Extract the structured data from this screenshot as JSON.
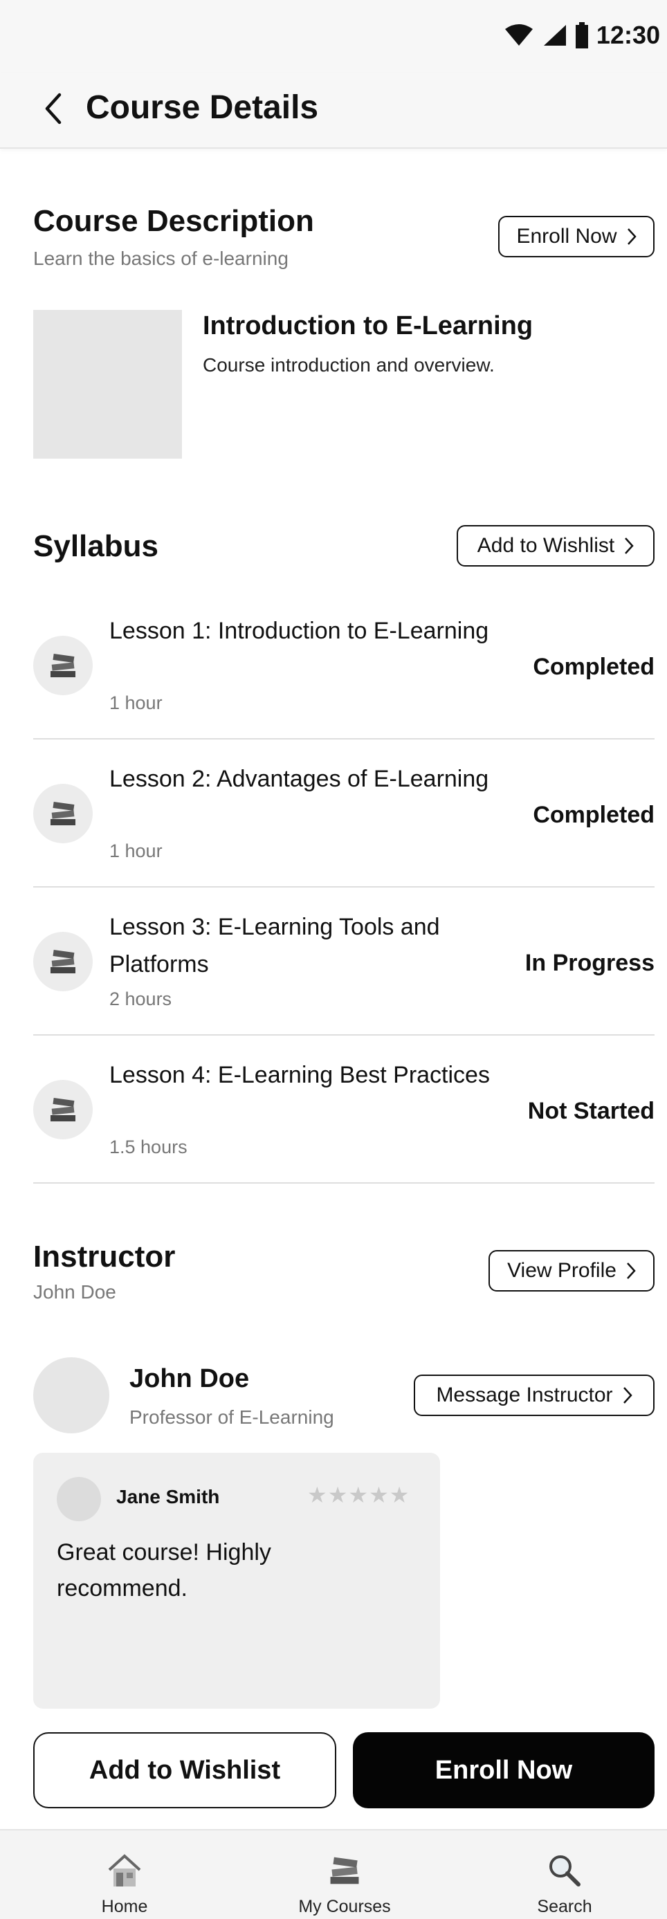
{
  "status_bar": {
    "time": "12:30"
  },
  "app_bar": {
    "title": "Course Details"
  },
  "course_description": {
    "heading": "Course Description",
    "subtitle": "Learn the basics of e-learning",
    "enroll_button": "Enroll Now",
    "course_title": "Introduction to E-Learning",
    "course_summary": "Course introduction and overview."
  },
  "syllabus": {
    "heading": "Syllabus",
    "wishlist_button": "Add to Wishlist",
    "lessons": [
      {
        "title": "Lesson 1: Introduction to E-Learning",
        "duration": "1 hour",
        "status": "Completed",
        "icon": "books-icon"
      },
      {
        "title": "Lesson 2: Advantages of E-Learning",
        "duration": "1 hour",
        "status": "Completed",
        "icon": "books-icon"
      },
      {
        "title": "Lesson 3: E-Learning Tools and Platforms",
        "duration": "2 hours",
        "status": "In Progress",
        "icon": "books-icon"
      },
      {
        "title": "Lesson 4: E-Learning Best Practices",
        "duration": "1.5 hours",
        "status": "Not Started",
        "icon": "books-icon"
      }
    ]
  },
  "instructor": {
    "heading": "Instructor",
    "subtitle": "John Doe",
    "view_profile_button": "View Profile",
    "name": "John Doe",
    "role": "Professor of E-Learning",
    "message_button": "Message Instructor"
  },
  "review": {
    "reviewer": "Jane Smith",
    "stars": "★★★★★",
    "text": "Great course! Highly recommend."
  },
  "cta": {
    "wishlist": "Add to Wishlist",
    "enroll": "Enroll Now"
  },
  "bottom_nav": {
    "items": [
      {
        "label": "Home",
        "icon": "home-icon"
      },
      {
        "label": "My Courses",
        "icon": "books-icon"
      },
      {
        "label": "Search",
        "icon": "search-icon"
      }
    ]
  }
}
